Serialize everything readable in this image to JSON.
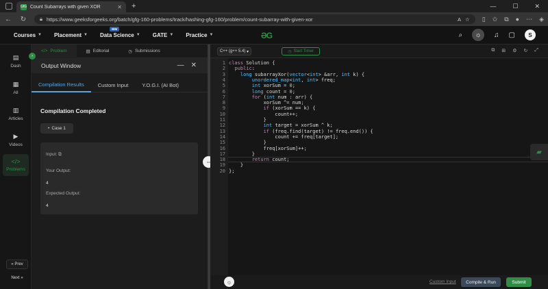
{
  "browser": {
    "tab_title": "Count Subarrays with given XOR",
    "tab_favicon": "GfG",
    "url": "https://www.geeksforgeeks.org/batch/gfg-160-problems/track/hashing-gfg-160/problem/count-subarray-with-given-xor"
  },
  "header": {
    "nav": [
      {
        "label": "Courses",
        "badge": ""
      },
      {
        "label": "Placement",
        "badge": ""
      },
      {
        "label": "Data Science",
        "badge": "IBM"
      },
      {
        "label": "GATE",
        "badge": ""
      },
      {
        "label": "Practice",
        "badge": ""
      }
    ],
    "avatar_letter": "S",
    "accent": "#2f8d46"
  },
  "rail": {
    "items": [
      {
        "label": "Dash",
        "icon": "dashboard-icon"
      },
      {
        "label": "All",
        "icon": "grid-icon"
      },
      {
        "label": "Articles",
        "icon": "book-icon"
      },
      {
        "label": "Videos",
        "icon": "video-icon"
      },
      {
        "label": "Problems",
        "icon": "code-icon"
      }
    ],
    "prev": "Prev",
    "next": "Next"
  },
  "problem_tabs": [
    "Problem",
    "Editorial",
    "Submissions"
  ],
  "output": {
    "title": "Output Window",
    "tabs": [
      "Compilation Results",
      "Custom Input",
      "Y.O.G.I. (AI Bot)"
    ],
    "status": "Compilation Completed",
    "case": "Case 1",
    "input_label": "Input:",
    "your_output_label": "Your Output:",
    "your_output": "4",
    "expected_label": "Expected Output:",
    "expected": "4"
  },
  "editor": {
    "language": "C++ (g++ 5.4)",
    "timer": "Start Timer",
    "lines": [
      "class Solution {",
      "  public:",
      "    long subarrayXor(vector<int> &arr, int k) {",
      "        unordered_map<int, int> freq;",
      "        int xorSum = 0;",
      "        long count = 0;",
      "        for (int num : arr) {",
      "            xorSum ^= num;",
      "            if (xorSum == k) {",
      "                count++;",
      "            }",
      "            int target = xorSum ^ k;",
      "            if (freq.find(target) != freq.end()) {",
      "                count += freq[target];",
      "            }",
      "            freq[xorSum]++;",
      "        }",
      "        return count;",
      "    }",
      "};"
    ],
    "custom_input": "Custom Input",
    "compile_run": "Compile & Run",
    "submit": "Submit"
  }
}
